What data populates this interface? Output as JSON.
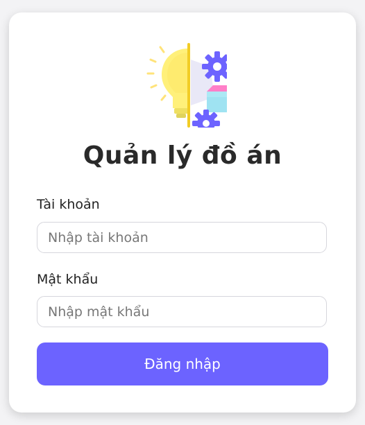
{
  "login": {
    "title": "Quản lý đồ án",
    "username_label": "Tài khoản",
    "username_placeholder": "Nhập tài khoản",
    "username_value": "",
    "password_label": "Mật khẩu",
    "password_placeholder": "Nhập mật khẩu",
    "password_value": "",
    "submit_label": "Đăng nhập"
  },
  "icons": {
    "logo": "lightbulb-gears-cube-illustration"
  },
  "colors": {
    "accent": "#6c63ff",
    "title": "#2a2a2a",
    "bulb": "#fff07a",
    "gear": "#6d63ff",
    "cube_top": "#ff7fc8",
    "cube_side": "#9fe3f2"
  }
}
